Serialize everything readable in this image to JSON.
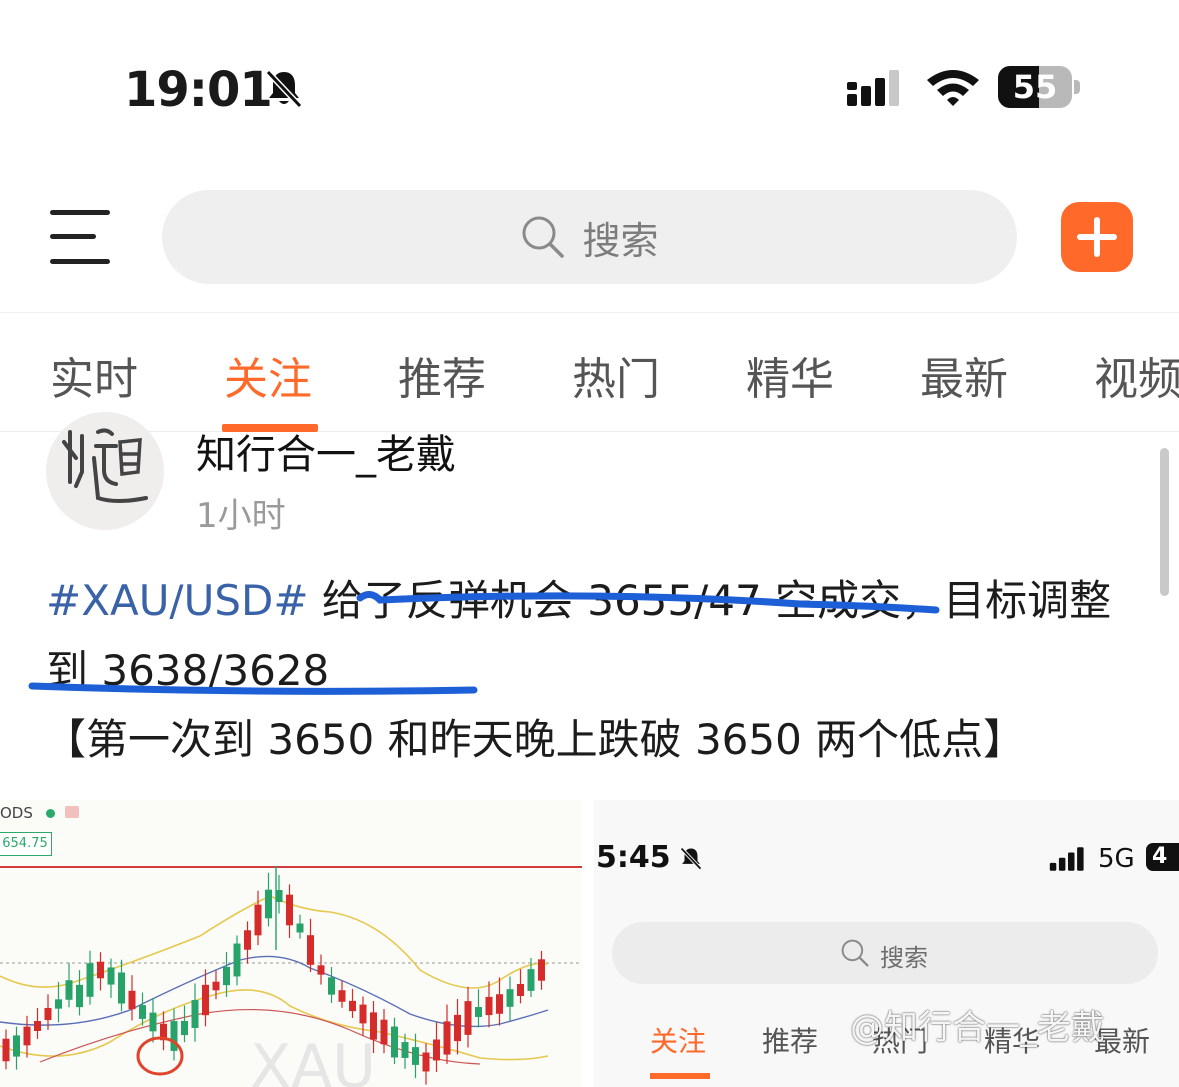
{
  "status_bar": {
    "time": "19:01",
    "battery": "55",
    "icons": [
      "bell-muted-icon",
      "signal-icon",
      "wifi-icon",
      "battery-icon"
    ]
  },
  "top_bar": {
    "search_placeholder": "搜索",
    "icons": [
      "menu-icon",
      "search-icon",
      "plus-icon"
    ],
    "accent_color": "#ff6a2b"
  },
  "tabs": [
    {
      "label": "实时",
      "active": false
    },
    {
      "label": "关注",
      "active": true
    },
    {
      "label": "推荐",
      "active": false
    },
    {
      "label": "热门",
      "active": false
    },
    {
      "label": "精华",
      "active": false
    },
    {
      "label": "最新",
      "active": false
    },
    {
      "label": "视频",
      "active": false
    }
  ],
  "post": {
    "author": "知行合一_老戴",
    "time": "1小时",
    "hashtag": "#XAU/USD#",
    "text_part1": " 给了反弹机会 3655/47 空成交，目标调整",
    "text_part2": "到 3638/3628",
    "note": "【第一次到 3650 和昨天晚上跌破 3650 两个低点】",
    "hashtag_color": "#3a62a8"
  },
  "images": {
    "left": {
      "legend": "ODS",
      "price_label": "654.75"
    },
    "right": {
      "time": "5:45",
      "network": "5G",
      "battery": "4",
      "search_label": "搜索",
      "tabs": [
        "关注",
        "推荐",
        "热门",
        "精华",
        "最新"
      ],
      "watermark": "@知行合一_老戴"
    }
  }
}
